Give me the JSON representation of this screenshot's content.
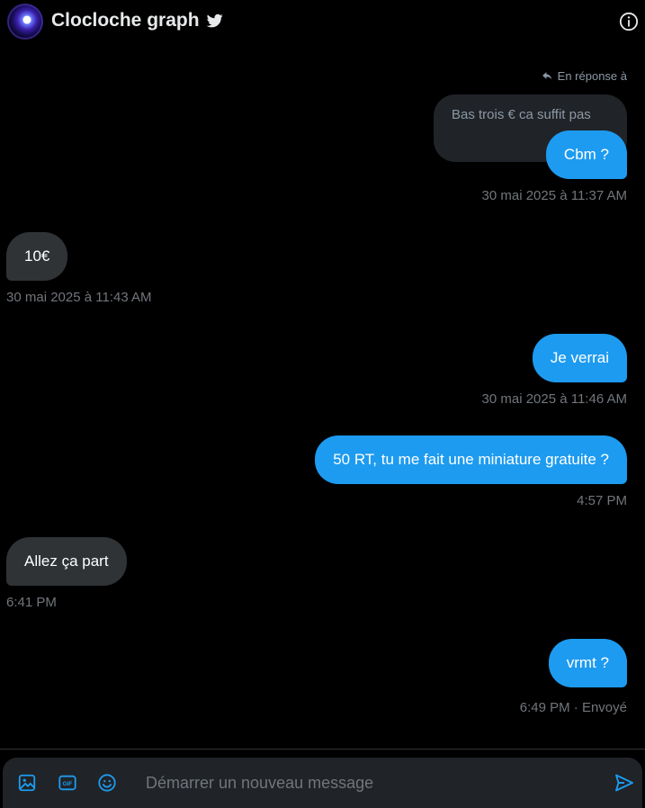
{
  "header": {
    "title": "Clocloche graph",
    "verified_icon": "bird-icon",
    "info_icon": "info-icon"
  },
  "reply_context": {
    "label": "En réponse à",
    "quoted_text": "Bas trois € ca suffit pas"
  },
  "messages": [
    {
      "direction": "out",
      "text": "Cbm ?",
      "timestamp": "30 mai 2025 à 11:37 AM"
    },
    {
      "direction": "in",
      "text": "10€",
      "timestamp": "30 mai 2025 à 11:43 AM"
    },
    {
      "direction": "out",
      "text": "Je verrai",
      "timestamp": "30 mai 2025 à 11:46 AM"
    },
    {
      "direction": "out",
      "text": "50 RT, tu me fait une miniature gratuite ?",
      "timestamp": "4:57 PM"
    },
    {
      "direction": "in",
      "text": "Allez ça part",
      "timestamp": "6:41 PM"
    },
    {
      "direction": "out",
      "text": "vrmt ?",
      "timestamp": "6:49 PM · Envoyé"
    }
  ],
  "composer": {
    "placeholder": "Démarrer un nouveau message",
    "value": "",
    "icons": [
      "image-icon",
      "gif-icon",
      "emoji-icon",
      "send-icon"
    ]
  },
  "colors": {
    "background": "#000000",
    "outgoing_bubble": "#1d9bf0",
    "incoming_bubble": "#2f3336",
    "accent": "#1d9bf0",
    "muted_text": "#71767b"
  }
}
